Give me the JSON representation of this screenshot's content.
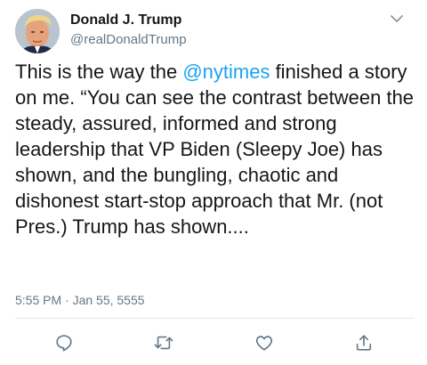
{
  "author": {
    "display_name": "Donald J. Trump",
    "handle": "@realDonaldTrump"
  },
  "tweet": {
    "text_before": "This is the way the ",
    "mention": "@nytimes",
    "text_after": " finished a story on me. “You can see the contrast between the steady, assured, informed and strong leadership that VP Biden (Sleepy Joe) has shown, and the bungling, chaotic and dishonest start-stop approach that Mr. (not Pres.) Trump has shown....",
    "timestamp": "5:55 PM · Jan 55, 5555"
  },
  "icons": {
    "menu": "chevron-down-icon",
    "reply": "reply-icon",
    "retweet": "retweet-icon",
    "like": "heart-icon",
    "share": "share-icon"
  },
  "colors": {
    "link": "#1da1f2",
    "secondary_text": "#657786",
    "icon": "#657786",
    "divider": "#e1e8ed"
  }
}
